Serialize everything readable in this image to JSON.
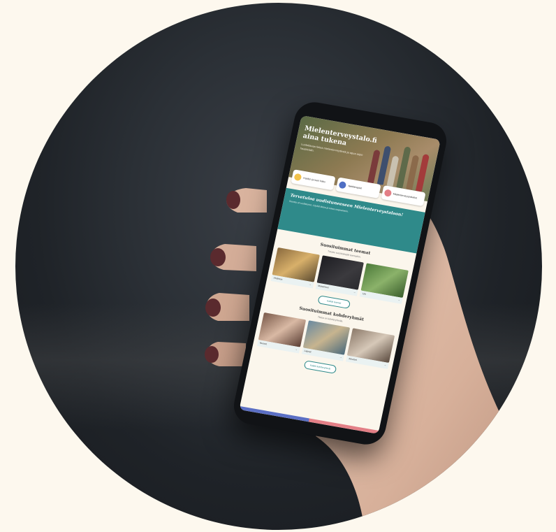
{
  "hero": {
    "title": "Mielenterveystalo.fi aina tukena",
    "subtitle": "Luotettavaa tietoa mielenterveydestä ja apua arjen haasteisiin."
  },
  "quick_cards": [
    {
      "label": "Hoidon ja tuen haku",
      "color": "#f2c24b"
    },
    {
      "label": "Nettiterapiat",
      "color": "#4f6fc4"
    },
    {
      "label": "Mielenterveyspalvelut",
      "color": "#e37f86"
    }
  ],
  "banner": {
    "title": "Tervetuloa uudistuneeseen Mielenterveystaloon!",
    "text": "Sivusto on uudistunut. Löydät tietoa ja tukea nopeammin."
  },
  "sections": [
    {
      "title": "Suosituimmat teemat",
      "subtitle": "Tutustu suosituimpiin teemoihin.",
      "tiles": [
        "Ahdistus",
        "Masennus",
        "Uni"
      ],
      "button": "Kaikki teemat"
    },
    {
      "title": "Suosituimmat kohderyhmät",
      "subtitle": "Tietoa eri kohderyhmille.",
      "tiles": [
        "Nuoret",
        "Lapset",
        "Aikuiset"
      ],
      "button": "Kaikki kohderyhmät"
    }
  ],
  "colors": {
    "teal": "#2f8a8a",
    "page_bg": "#fdf8ee"
  }
}
